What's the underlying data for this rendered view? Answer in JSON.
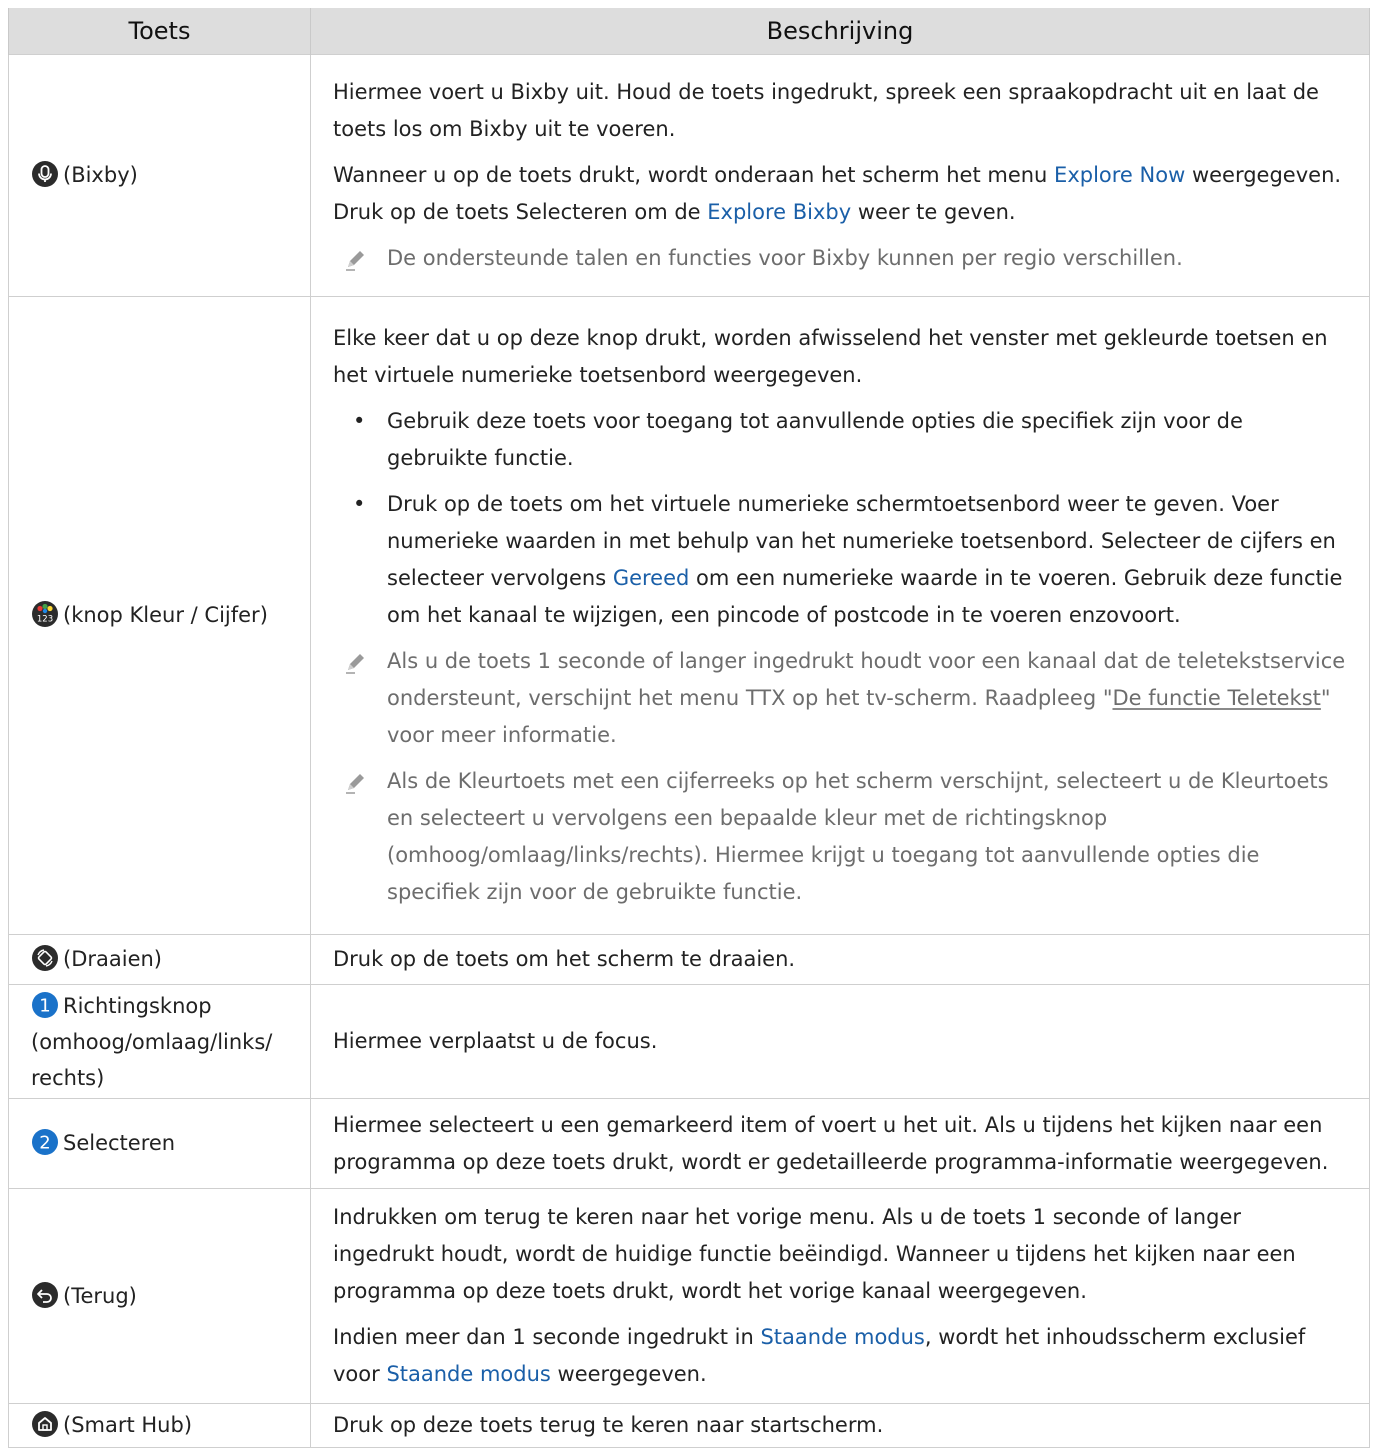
{
  "table": {
    "headers": [
      "Toets",
      "Beschrijving"
    ],
    "rows": [
      {
        "icon": "microphone-icon",
        "key": "(Bixby)",
        "para1": "Hiermee voert u Bixby uit. Houd de toets ingedrukt, spreek een spraakopdracht uit en laat de toets los om Bixby uit te voeren.",
        "para2_a": "Wanneer u op de toets drukt, wordt onderaan het scherm het menu ",
        "para2_link1": "Explore Now",
        "para2_b": " weergegeven. Druk op de toets Selecteren om de ",
        "para2_link2": "Explore Bixby",
        "para2_c": " weer te geven.",
        "note": "De ondersteunde talen en functies voor Bixby kunnen per regio verschillen."
      },
      {
        "icon": "color-123-icon",
        "key": "(knop Kleur / Cijfer)",
        "para1": "Elke keer dat u op deze knop drukt, worden afwisselend het venster met gekleurde toetsen en het virtuele numerieke toetsenbord weergegeven.",
        "bullet1": "Gebruik deze toets voor toegang tot aanvullende opties die specifiek zijn voor de gebruikte functie.",
        "bullet2_a": "Druk op de toets om het virtuele numerieke schermtoetsenbord weer te geven. Voer numerieke waarden in met behulp van het numerieke toetsenbord. Selecteer de cijfers en selecteer vervolgens ",
        "bullet2_link": "Gereed",
        "bullet2_b": " om een numerieke waarde in te voeren. Gebruik deze functie om het kanaal te wijzigen, een pincode of postcode in te voeren enzovoort.",
        "note1_a": "Als u de toets 1 seconde of langer ingedrukt houdt voor een kanaal dat de teletekstservice ondersteunt, verschijnt het menu TTX op het tv-scherm. Raadpleeg \"",
        "note1_link": "De functie Teletekst",
        "note1_b": "\" voor meer informatie.",
        "note2": "Als de Kleurtoets met een cijferreeks op het scherm verschijnt, selecteert u de Kleurtoets en selecteert u vervolgens een bepaalde kleur met de richtingsknop (omhoog/omlaag/links/rechts). Hiermee krijgt u toegang tot aanvullende opties die specifiek zijn voor de gebruikte functie."
      },
      {
        "icon": "rotate-icon",
        "key": "(Draaien)",
        "desc": "Druk op de toets om het scherm te draaien."
      },
      {
        "icon": "number-1-icon",
        "icon_text": "1",
        "key": "Richtingsknop (omhoog/omlaag/links/ rechts)",
        "desc": "Hiermee verplaatst u de focus."
      },
      {
        "icon": "number-2-icon",
        "icon_text": "2",
        "key": "Selecteren",
        "desc": "Hiermee selecteert u een gemarkeerd item of voert u het uit. Als u tijdens het kijken naar een programma op deze toets drukt, wordt er gedetailleerde programma-informatie weergegeven."
      },
      {
        "icon": "back-arrow-icon",
        "key": "(Terug)",
        "para1": "Indrukken om terug te keren naar het vorige menu. Als u de toets 1 seconde of langer ingedrukt houdt, wordt de huidige functie beëindigd. Wanneer u tijdens het kijken naar een programma op deze toets drukt, wordt het vorige kanaal weergegeven.",
        "para2_a": "Indien meer dan 1 seconde ingedrukt in ",
        "para2_link1": "Staande modus",
        "para2_b": ", wordt het inhoudsscherm exclusief voor ",
        "para2_link2": "Staande modus",
        "para2_c": " weergegeven."
      },
      {
        "icon": "home-icon",
        "key": "(Smart Hub)",
        "desc": "Druk op deze toets terug te keren naar startscherm."
      }
    ]
  },
  "colors": {
    "header_bg": "#dddddd",
    "link": "#1a5fa8",
    "note_text": "#6d6d6d",
    "icon_dark": "#2b2b2b",
    "icon_blue": "#1a72c9"
  }
}
